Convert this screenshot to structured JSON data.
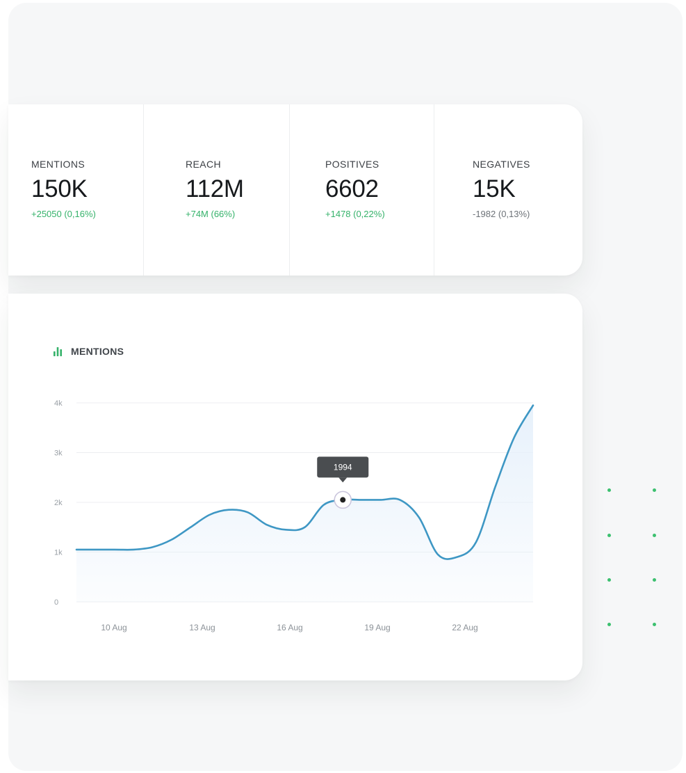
{
  "stats": [
    {
      "label": "MENTIONS",
      "value": "150K",
      "delta": "+25050 (0,16%)",
      "trend": "positive"
    },
    {
      "label": "REACH",
      "value": "112M",
      "delta": "+74M (66%)",
      "trend": "positive"
    },
    {
      "label": "POSITIVES",
      "value": "6602",
      "delta": "+1478 (0,22%)",
      "trend": "positive"
    },
    {
      "label": "NEGATIVES",
      "value": "15K",
      "delta": "-1982 (0,13%)",
      "trend": "negative"
    }
  ],
  "colors": {
    "accent_green": "#35b26a",
    "line": "#3e97c4",
    "area": "#e7f1fb",
    "tooltip_bg": "#4a4d50"
  },
  "chart_icon": "bar-chart-icon",
  "chart_data": {
    "type": "area",
    "title": "MENTIONS",
    "xlabel": "",
    "ylabel": "",
    "ylim": [
      0,
      4000
    ],
    "yticks": [
      0,
      1000,
      2000,
      3000,
      4000
    ],
    "ytick_labels": [
      "0",
      "1k",
      "2k",
      "3k",
      "4k"
    ],
    "xtick_labels": [
      "10 Aug",
      "13 Aug",
      "16 Aug",
      "19 Aug",
      "22 Aug"
    ],
    "x": [
      0,
      2,
      3,
      4,
      5,
      6,
      7,
      8,
      9,
      10,
      11,
      12,
      13,
      14,
      15,
      16,
      17,
      18,
      19,
      20,
      21,
      22,
      23,
      24
    ],
    "values": [
      1050,
      1050,
      1050,
      1100,
      1250,
      1500,
      1750,
      1850,
      1800,
      1550,
      1450,
      1500,
      1950,
      2050,
      2050,
      2050,
      2050,
      1700,
      950,
      900,
      1200,
      2300,
      3300,
      3950
    ],
    "tooltip": {
      "label": "1994",
      "x_index": 13
    },
    "grid": true,
    "legend": "none"
  }
}
